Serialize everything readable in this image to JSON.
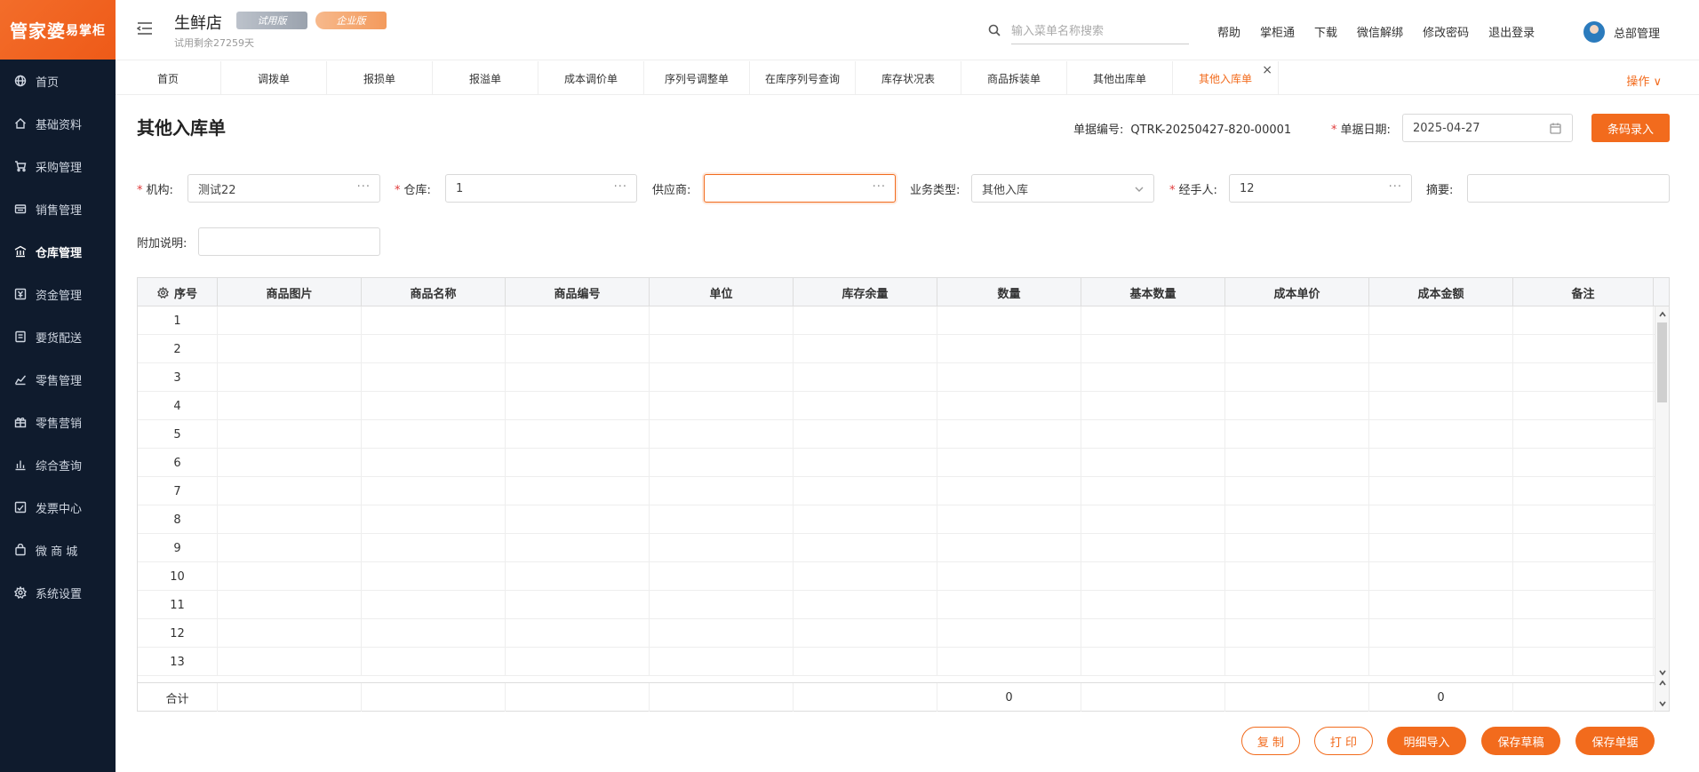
{
  "app": {
    "logo_main": "管家婆",
    "logo_sub": "易掌柜",
    "brand_color": "#f26b1d"
  },
  "sidebar": {
    "items": [
      {
        "label": "首页",
        "icon": "globe-icon"
      },
      {
        "label": "基础资料",
        "icon": "home-icon"
      },
      {
        "label": "采购管理",
        "icon": "cart-icon"
      },
      {
        "label": "销售管理",
        "icon": "sales-icon"
      },
      {
        "label": "仓库管理",
        "icon": "warehouse-icon"
      },
      {
        "label": "资金管理",
        "icon": "money-icon"
      },
      {
        "label": "要货配送",
        "icon": "delivery-icon"
      },
      {
        "label": "零售管理",
        "icon": "retail-chart-icon"
      },
      {
        "label": "零售营销",
        "icon": "gift-icon"
      },
      {
        "label": "综合查询",
        "icon": "bar-chart-icon"
      },
      {
        "label": "发票中心",
        "icon": "invoice-icon"
      },
      {
        "label": "微 商 城",
        "icon": "shop-bag-icon"
      },
      {
        "label": "系统设置",
        "icon": "gear-icon"
      }
    ],
    "active_index": 4
  },
  "header": {
    "store_name": "生鲜店",
    "badge_trial": "试用版",
    "badge_enterprise": "企业版",
    "trial_left": "试用剩余27259天",
    "search_placeholder": "输入菜单名称搜索",
    "links": [
      "帮助",
      "掌柜通",
      "下载",
      "微信解绑",
      "修改密码",
      "退出登录"
    ],
    "user_name": "总部管理"
  },
  "tabs": {
    "items": [
      "首页",
      "调拨单",
      "报损单",
      "报溢单",
      "成本调价单",
      "序列号调整单",
      "在库序列号查询",
      "库存状况表",
      "商品拆装单",
      "其他出库单",
      "其他入库单"
    ],
    "active_index": 10,
    "ops_label": "操作 ∨"
  },
  "form": {
    "title": "其他入库单",
    "doc_no_label": "单据编号:",
    "doc_no": "QTRK-20250427-820-00001",
    "date_label": "单据日期:",
    "date": "2025-04-27",
    "barcode_btn": "条码录入",
    "org_label": "机构:",
    "org_value": "测试22",
    "warehouse_label": "仓库:",
    "warehouse_value": "1",
    "supplier_label": "供应商:",
    "supplier_value": "",
    "biz_type_label": "业务类型:",
    "biz_type_value": "其他入库",
    "handler_label": "经手人:",
    "handler_value": "12",
    "summary_label": "摘要:",
    "summary_value": "",
    "note_label": "附加说明:",
    "note_value": ""
  },
  "table": {
    "columns": [
      "序号",
      "商品图片",
      "商品名称",
      "商品编号",
      "单位",
      "库存余量",
      "数量",
      "基本数量",
      "成本单价",
      "成本金额",
      "备注"
    ],
    "rows": [
      "1",
      "2",
      "3",
      "4",
      "5",
      "6",
      "7",
      "8",
      "9",
      "10",
      "11",
      "12",
      "13"
    ],
    "footer": {
      "label": "合计",
      "quantity_total": "0",
      "cost_total": "0"
    }
  },
  "actions": {
    "copy": "复 制",
    "print": "打 印",
    "detail_import": "明细导入",
    "save_draft": "保存草稿",
    "save_doc": "保存单据"
  }
}
